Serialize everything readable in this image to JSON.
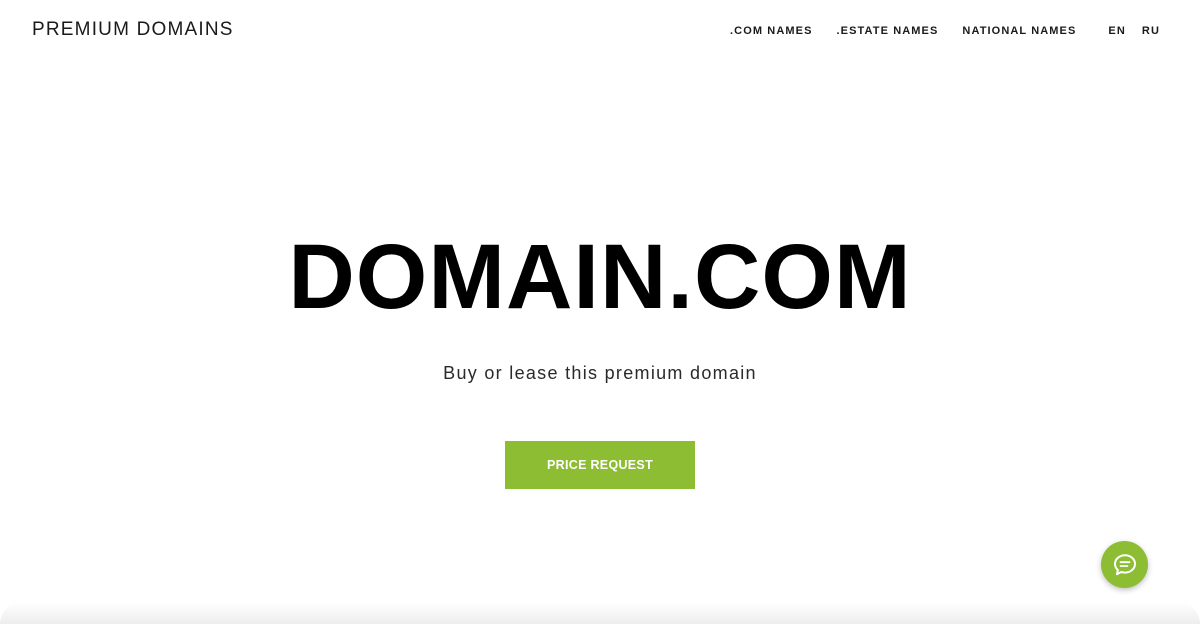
{
  "header": {
    "brand": "PREMIUM DOMAINS",
    "nav": [
      {
        "label": ".COM NAMES"
      },
      {
        "label": ".ESTATE NAMES"
      },
      {
        "label": "NATIONAL NAMES"
      }
    ],
    "languages": [
      {
        "label": "EN"
      },
      {
        "label": "RU"
      }
    ]
  },
  "hero": {
    "title": "DOMAIN.COM",
    "subtitle": "Buy or lease this premium domain",
    "cta_label": "PRICE REQUEST"
  },
  "chat": {
    "icon": "chat-bubble-icon"
  },
  "colors": {
    "accent": "#8cbd32",
    "text": "#000000",
    "background": "#ffffff"
  }
}
